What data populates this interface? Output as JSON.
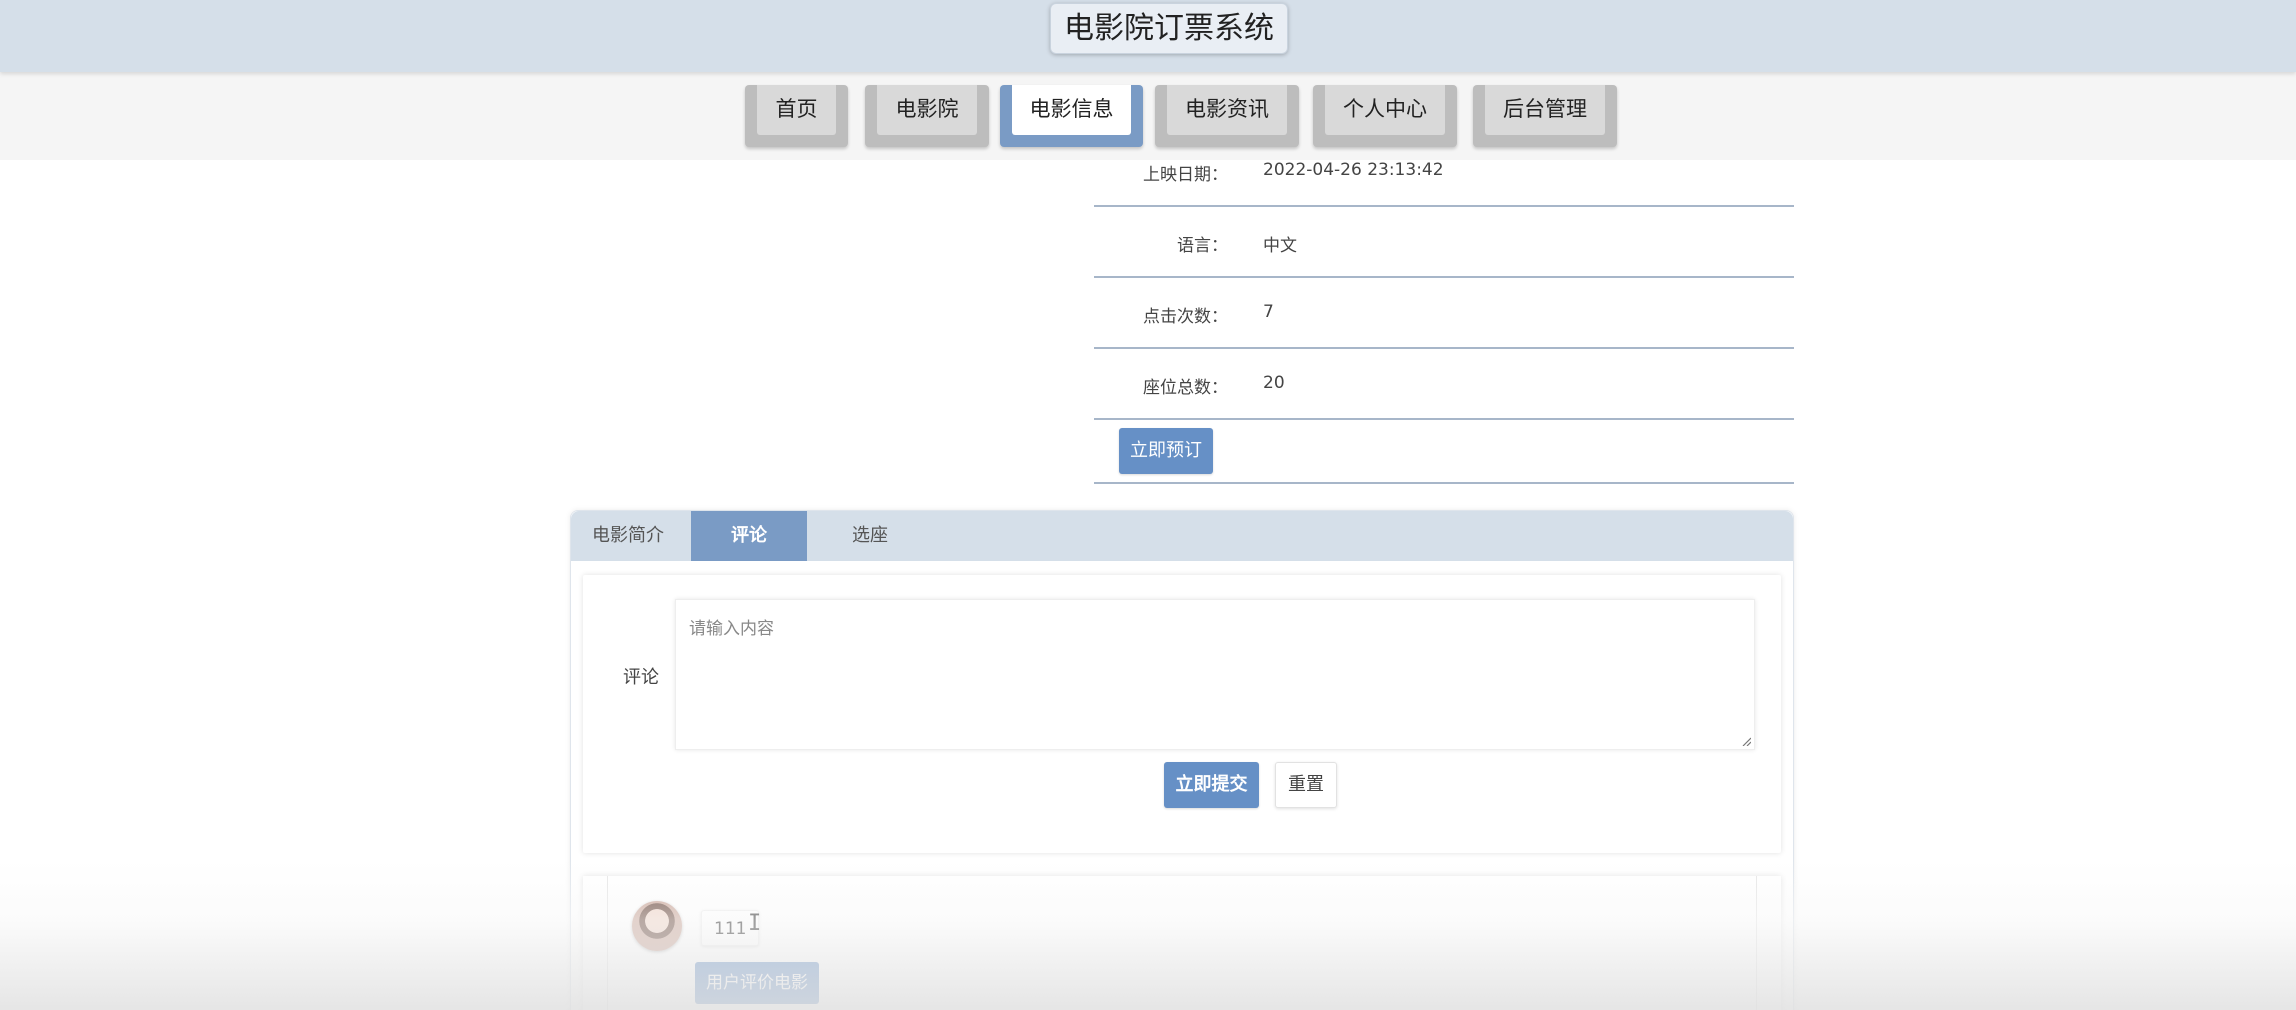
{
  "header": {
    "title": "电影院订票系统"
  },
  "nav": {
    "items": [
      {
        "label": "首页"
      },
      {
        "label": "电影院"
      },
      {
        "label": "电影信息",
        "active": true
      },
      {
        "label": "电影资讯"
      },
      {
        "label": "个人中心"
      },
      {
        "label": "后台管理"
      }
    ]
  },
  "details": {
    "release_date": {
      "label": "上映日期：",
      "value": "2022-04-26 23:13:42"
    },
    "language": {
      "label": "语言：",
      "value": "中文"
    },
    "clicks": {
      "label": "点击次数：",
      "value": "7"
    },
    "seats": {
      "label": "座位总数：",
      "value": "20"
    },
    "book_button": "立即预订"
  },
  "tabs": {
    "items": [
      {
        "label": "电影简介"
      },
      {
        "label": "评论",
        "active": true
      },
      {
        "label": "选座"
      }
    ]
  },
  "comment_form": {
    "label": "评论",
    "placeholder": "请输入内容",
    "submit_label": "立即提交",
    "reset_label": "重置"
  },
  "comments": [
    {
      "text": "111",
      "tag": "用户评价电影"
    }
  ],
  "colors": {
    "header_bg": "#d5dfe9",
    "accent": "#6690c6",
    "tab_active": "#7a9bc5"
  }
}
